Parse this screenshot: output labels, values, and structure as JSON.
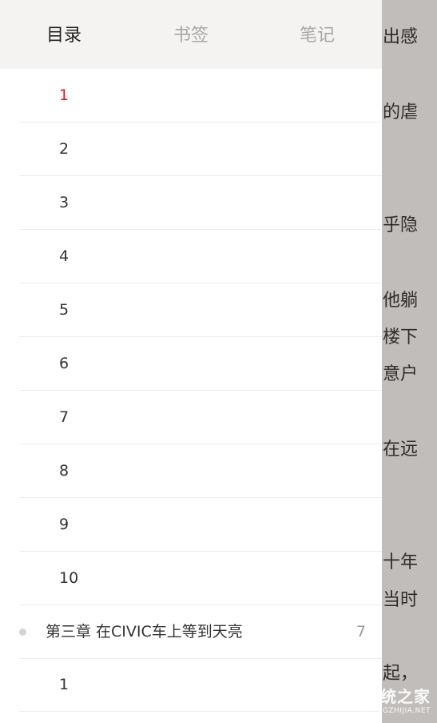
{
  "tabs": [
    {
      "label": "目录",
      "active": true
    },
    {
      "label": "书签",
      "active": false
    },
    {
      "label": "笔记",
      "active": false
    }
  ],
  "toc": {
    "items": [
      {
        "label": "1",
        "current": true
      },
      {
        "label": "2"
      },
      {
        "label": "3"
      },
      {
        "label": "4"
      },
      {
        "label": "5"
      },
      {
        "label": "6"
      },
      {
        "label": "7"
      },
      {
        "label": "8"
      },
      {
        "label": "9"
      },
      {
        "label": "10"
      }
    ],
    "chapter": {
      "title": "第三章 在CIVIC车上等到天亮",
      "page": "7"
    },
    "after_chapter": [
      {
        "label": "1"
      }
    ]
  },
  "reader_fragments": [
    "出感",
    "的虐",
    "乎隐",
    "他躺",
    "楼下",
    "意户",
    "在远",
    "十年",
    "当时",
    "起，"
  ],
  "watermark": {
    "main": "系统之家",
    "sub": "XITONGZHIJIA.NET"
  },
  "colors": {
    "accent": "#e8141b",
    "overlay": "#c1bdba"
  }
}
